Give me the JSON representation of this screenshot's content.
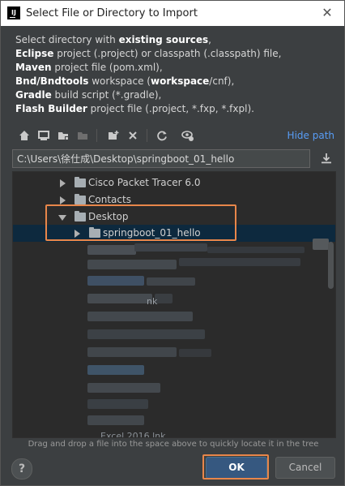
{
  "window": {
    "title": "Select File or Directory to Import",
    "icon_text": "IJ",
    "close_symbol": "✕"
  },
  "description": {
    "line1_prefix": "Select directory with ",
    "line1_bold": "existing sources",
    "line1_suffix": ",",
    "line2_bold": "Eclipse",
    "line2_rest": " project (.project) or classpath (.classpath) file,",
    "line3_bold": "Maven",
    "line3_rest": " project file (pom.xml),",
    "line4_bold": "Bnd/Bndtools",
    "line4_mid": " workspace (",
    "line4_bold2": "workspace",
    "line4_end": "/cnf),",
    "line5_bold": "Gradle",
    "line5_rest": " build script (*.gradle),",
    "line6_bold": "Flash Builder",
    "line6_rest": " project file (.project, *.fxp, *.fxpl)."
  },
  "toolbar": {
    "hide_path_label": "Hide path",
    "icons": [
      "home-icon",
      "desktop-icon",
      "project-icon",
      "module-icon",
      "new-folder-icon",
      "delete-icon",
      "refresh-icon",
      "show-hidden-icon"
    ]
  },
  "path": {
    "value": "C:\\Users\\徐仕成\\Desktop\\springboot_01_hello"
  },
  "tree": {
    "items": [
      {
        "label": "Cisco Packet Tracer 6.0",
        "expanded": false,
        "selected": false
      },
      {
        "label": "Contacts",
        "expanded": false,
        "selected": false
      },
      {
        "label": "Desktop",
        "expanded": true,
        "selected": false
      },
      {
        "label": "springboot_01_hello",
        "expanded": false,
        "selected": true
      }
    ],
    "obscured_labels": [
      "nk",
      "Excel 2016 lnk"
    ]
  },
  "hint": "Drag and drop a file into the space above to quickly locate it in the tree",
  "buttons": {
    "help": "?",
    "ok": "OK",
    "cancel": "Cancel"
  },
  "colors": {
    "accent": "#589df6",
    "highlight": "#e8864a",
    "ok_bg": "#365880",
    "selection": "#0d293e"
  }
}
